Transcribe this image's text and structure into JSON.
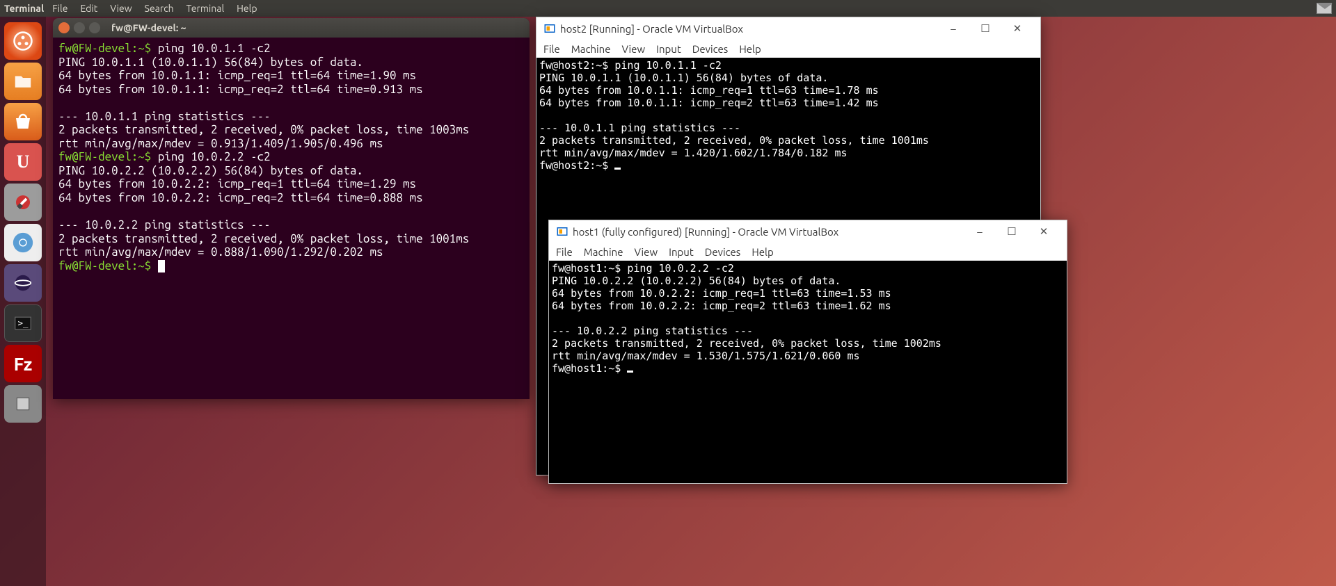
{
  "topbar": {
    "app": "Terminal",
    "menus": [
      "File",
      "Edit",
      "View",
      "Search",
      "Terminal",
      "Help"
    ]
  },
  "launcher": {
    "items": [
      "dash",
      "files",
      "software",
      "ubuntu-one",
      "settings",
      "chromium",
      "eclipse",
      "terminal",
      "filezilla",
      "app"
    ]
  },
  "ubuntu_terminal": {
    "title": "fw@FW-devel: ~",
    "prompt1": "fw@FW-devel:~$ ",
    "cmd1": "ping 10.0.1.1 -c2",
    "out1": "PING 10.0.1.1 (10.0.1.1) 56(84) bytes of data.\n64 bytes from 10.0.1.1: icmp_req=1 ttl=64 time=1.90 ms\n64 bytes from 10.0.1.1: icmp_req=2 ttl=64 time=0.913 ms\n\n--- 10.0.1.1 ping statistics ---\n2 packets transmitted, 2 received, 0% packet loss, time 1003ms\nrtt min/avg/max/mdev = 0.913/1.409/1.905/0.496 ms",
    "prompt2": "fw@FW-devel:~$ ",
    "cmd2": "ping 10.0.2.2 -c2",
    "out2": "PING 10.0.2.2 (10.0.2.2) 56(84) bytes of data.\n64 bytes from 10.0.2.2: icmp_req=1 ttl=64 time=1.29 ms\n64 bytes from 10.0.2.2: icmp_req=2 ttl=64 time=0.888 ms\n\n--- 10.0.2.2 ping statistics ---\n2 packets transmitted, 2 received, 0% packet loss, time 1001ms\nrtt min/avg/max/mdev = 0.888/1.090/1.292/0.202 ms",
    "prompt3": "fw@FW-devel:~$ "
  },
  "host2": {
    "title": "host2 [Running] - Oracle VM VirtualBox",
    "menus": [
      "File",
      "Machine",
      "View",
      "Input",
      "Devices",
      "Help"
    ],
    "body": "fw@host2:~$ ping 10.0.1.1 -c2\nPING 10.0.1.1 (10.0.1.1) 56(84) bytes of data.\n64 bytes from 10.0.1.1: icmp_req=1 ttl=63 time=1.78 ms\n64 bytes from 10.0.1.1: icmp_req=2 ttl=63 time=1.42 ms\n\n--- 10.0.1.1 ping statistics ---\n2 packets transmitted, 2 received, 0% packet loss, time 1001ms\nrtt min/avg/max/mdev = 1.420/1.602/1.784/0.182 ms\nfw@host2:~$ "
  },
  "host1": {
    "title": "host1 (fully configured) [Running] - Oracle VM VirtualBox",
    "menus": [
      "File",
      "Machine",
      "View",
      "Input",
      "Devices",
      "Help"
    ],
    "body": "fw@host1:~$ ping 10.0.2.2 -c2\nPING 10.0.2.2 (10.0.2.2) 56(84) bytes of data.\n64 bytes from 10.0.2.2: icmp_req=1 ttl=63 time=1.53 ms\n64 bytes from 10.0.2.2: icmp_req=2 ttl=63 time=1.62 ms\n\n--- 10.0.2.2 ping statistics ---\n2 packets transmitted, 2 received, 0% packet loss, time 1002ms\nrtt min/avg/max/mdev = 1.530/1.575/1.621/0.060 ms\nfw@host1:~$ "
  },
  "winbtns": {
    "min": "–",
    "max": "☐",
    "close": "✕"
  }
}
